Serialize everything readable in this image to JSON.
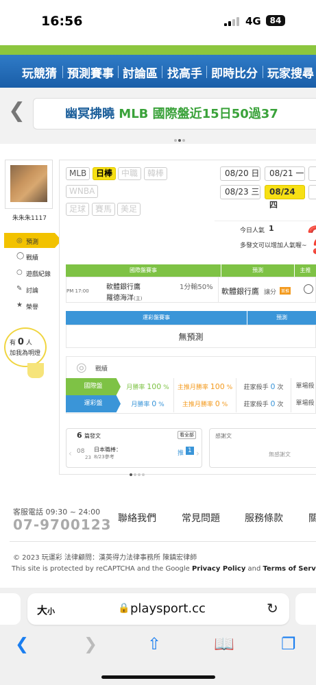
{
  "status": {
    "time": "16:56",
    "network": "4G",
    "battery": "84"
  },
  "nav": {
    "items": [
      "玩競猜",
      "預測賽事",
      "討論區",
      "找高手",
      "即時比分",
      "玩家搜尋"
    ]
  },
  "banner": {
    "name": "幽冥拂曉",
    "text": "MLB 國際盤近15日50過37"
  },
  "user": {
    "name": "朱朱朱1117",
    "menu": [
      "預測",
      "戰績",
      "遊戲紀錄",
      "討論",
      "榮譽"
    ],
    "fans_line1_prefix": "有",
    "fans_count": "0",
    "fans_line1_suffix": "人",
    "fans_line2": "加我為明燈"
  },
  "league_tags": [
    {
      "label": "MLB",
      "state": "normal"
    },
    {
      "label": "日棒",
      "state": "active"
    },
    {
      "label": "中職",
      "state": "disabled"
    },
    {
      "label": "韓棒",
      "state": "disabled"
    },
    {
      "label": "WNBA",
      "state": "disabled"
    },
    {
      "label": "足球",
      "state": "disabled"
    },
    {
      "label": "賽馬",
      "state": "disabled"
    },
    {
      "label": "美足",
      "state": "disabled"
    }
  ],
  "dates": [
    {
      "label": "08/20 日",
      "active": false
    },
    {
      "label": "08/21 一",
      "active": false
    },
    {
      "label": "08/23 三",
      "active": false
    },
    {
      "label": "08/24 四",
      "active": true
    }
  ],
  "popularity": {
    "label": "今日人氣",
    "value": "1",
    "hint": "多發文可以增加人氣喔~"
  },
  "intl_table": {
    "headers": [
      "國際盤賽事",
      "預測",
      "主推"
    ],
    "time": "PM 17:00",
    "home": "軟體銀行鷹",
    "away": "羅德海洋",
    "away_sup": "(主)",
    "line": "1分輸50%",
    "pick": "軟體銀行鷹",
    "pick_note": "讓分",
    "pick_badge": "首推"
  },
  "sport_table": {
    "headers": [
      "運彩盤賽事",
      "預測"
    ],
    "empty": "無預測"
  },
  "stats": {
    "title": "戰績",
    "rows": [
      {
        "label": "國際盤",
        "win": "月勝率",
        "win_val": "100",
        "win_unit": "%",
        "main": "主推月勝率",
        "main_val": "100",
        "main_unit": "%",
        "killer": "莊家殺手",
        "killer_val": "0",
        "killer_unit": "次",
        "single": "單場殺"
      },
      {
        "label": "運彩盤",
        "win": "月勝率",
        "win_val": "0",
        "win_unit": "%",
        "main": "主推月勝率",
        "main_val": "0",
        "main_unit": "%",
        "killer": "莊家殺手",
        "killer_val": "0",
        "killer_unit": "次",
        "single": "單場殺"
      }
    ]
  },
  "posts": {
    "count": "6",
    "title": "篇發文",
    "all_label": "看全部",
    "month": "08",
    "day": "23",
    "post_title": "日本職棒：",
    "post_sub": "8/23參考",
    "push_label": "推",
    "push_count": "1"
  },
  "thanks": {
    "title": "感謝文",
    "empty": "無感謝文"
  },
  "footer": {
    "hours": "客服電話 09:30 ~ 24:00",
    "phone": "07-9700123",
    "links": [
      "聯絡我們",
      "常見問題",
      "服務條款",
      "關"
    ],
    "copyright": "© 2023 玩運彩 法律顧問：漢英得力法律事務所 陳鎮宏律師",
    "captcha_pre": "This site is protected by reCAPTCHA and the Google ",
    "captcha_privacy": "Privacy Policy",
    "captcha_and": " and ",
    "captcha_terms": "Terms of Service"
  },
  "browser": {
    "text_size": "大",
    "text_size_small": "小",
    "url": "playsport.cc"
  },
  "colors": {
    "brand_blue": "#1a5ea8",
    "accent_yellow": "#f7e014",
    "green": "#7ec245",
    "sky": "#3a95d8"
  }
}
